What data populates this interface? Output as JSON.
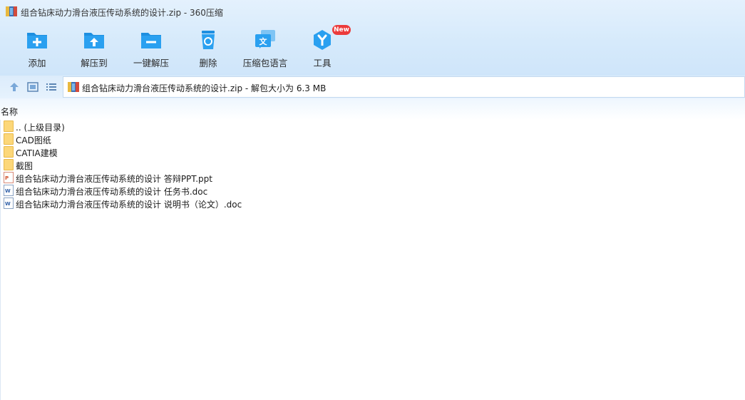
{
  "window": {
    "title": "组合钻床动力滑台液压传动系统的设计.zip - 360压缩"
  },
  "toolbar": {
    "items": [
      {
        "label": "添加",
        "icon": "add-folder-icon"
      },
      {
        "label": "解压到",
        "icon": "extract-to-icon"
      },
      {
        "label": "一键解压",
        "icon": "one-click-extract-icon"
      },
      {
        "label": "删除",
        "icon": "recycle-bin-icon"
      },
      {
        "label": "压缩包语言",
        "icon": "language-icon"
      },
      {
        "label": "工具",
        "icon": "tools-icon",
        "badge": "New"
      }
    ]
  },
  "navigation": {
    "address": "组合钻床动力滑台液压传动系统的设计.zip - 解包大小为 6.3 MB"
  },
  "file_list": {
    "column_name": "名称",
    "items": [
      {
        "name": ".. (上级目录)",
        "type": "folder"
      },
      {
        "name": "CAD图纸",
        "type": "folder"
      },
      {
        "name": "CATIA建模",
        "type": "folder"
      },
      {
        "name": "截图",
        "type": "folder"
      },
      {
        "name": "组合钻床动力滑台液压传动系统的设计 答辩PPT.ppt",
        "type": "ppt"
      },
      {
        "name": "组合钻床动力滑台液压传动系统的设计 任务书.doc",
        "type": "doc"
      },
      {
        "name": "组合钻床动力滑台液压传动系统的设计 说明书（论文）.doc",
        "type": "doc"
      }
    ]
  },
  "colors": {
    "accent": "#2196e8",
    "header_bg": "#d6eafb",
    "badge": "#ec3b3b",
    "folder": "#fcd779"
  }
}
